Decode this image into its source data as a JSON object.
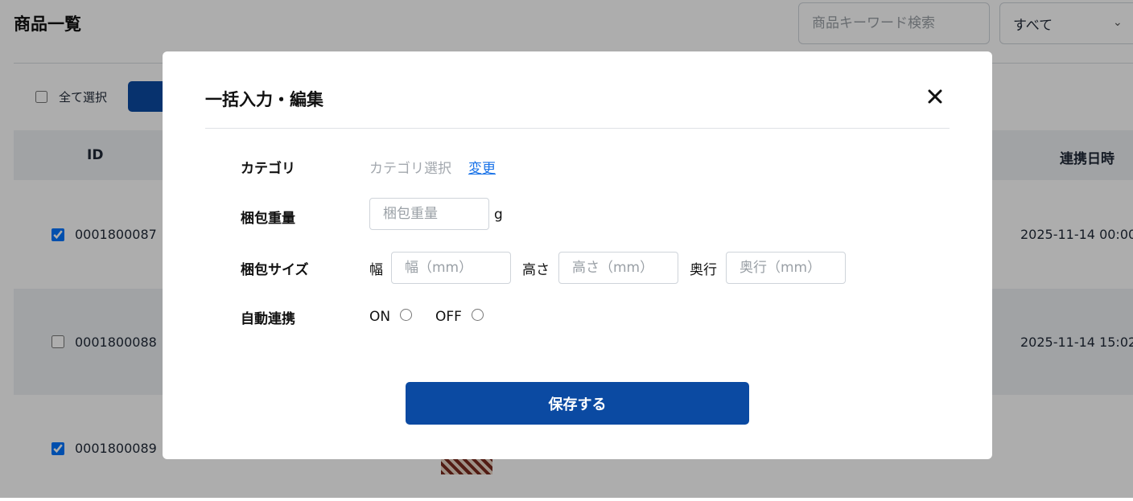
{
  "page": {
    "title": "商品一覧",
    "search_placeholder": "商品キーワード検索",
    "filter_value": "すべて",
    "select_all_label": "全て選択"
  },
  "table": {
    "headers": {
      "id": "ID",
      "sync_datetime": "連携日時"
    },
    "rows": [
      {
        "checked": true,
        "id": "0001800087",
        "sync_datetime": "2025-11-14 00:00"
      },
      {
        "checked": false,
        "id": "0001800088",
        "sync_datetime": "2025-11-14 15:02"
      },
      {
        "checked": true,
        "id": "0001800089",
        "sync_datetime": ""
      }
    ]
  },
  "modal": {
    "title": "一括入力・編集",
    "category": {
      "label": "カテゴリ",
      "value": "カテゴリ選択",
      "change_link": "変更"
    },
    "weight": {
      "label": "梱包重量",
      "placeholder": "梱包重量",
      "unit": "g"
    },
    "size": {
      "label": "梱包サイズ",
      "width_label": "幅",
      "width_placeholder": "幅（mm）",
      "height_label": "高さ",
      "height_placeholder": "高さ（mm）",
      "depth_label": "奥行",
      "depth_placeholder": "奥行（mm）"
    },
    "auto_sync": {
      "label": "自動連携",
      "on_label": "ON",
      "off_label": "OFF"
    },
    "save_label": "保存する"
  },
  "colors": {
    "primary": "#0b4aa2",
    "link": "#1a73e8",
    "overlay": "rgba(0,0,0,0.32)"
  },
  "icons": {
    "close": "close-icon",
    "chevron": "chevron-down-icon"
  }
}
